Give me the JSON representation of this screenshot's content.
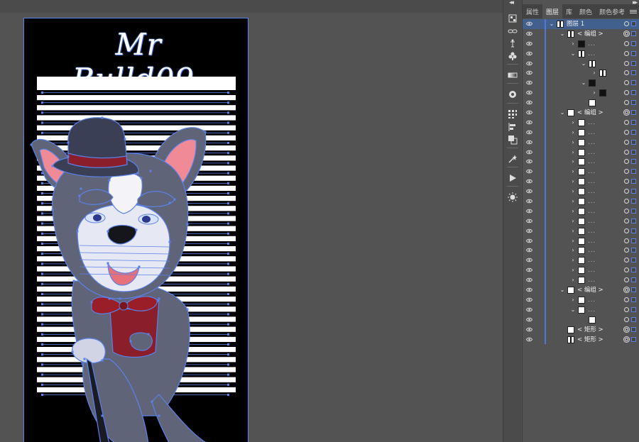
{
  "artwork": {
    "title": "Mr Bulld09."
  },
  "tools": [
    {
      "name": "artboards-icon"
    },
    {
      "name": "links-icon"
    },
    {
      "name": "puppet-warp-icon"
    },
    {
      "name": "symbols-icon"
    },
    {
      "name": "gradient-icon"
    },
    {
      "name": "appearance-icon"
    },
    {
      "name": "transform-grid-icon"
    },
    {
      "name": "align-icon"
    },
    {
      "name": "pathfinder-icon"
    },
    {
      "name": "magic-wand-icon"
    },
    {
      "name": "actions-icon"
    },
    {
      "name": "brightness-icon"
    }
  ],
  "panel": {
    "tabs": [
      {
        "label": "属性"
      },
      {
        "label": "图层"
      },
      {
        "label": "库"
      },
      {
        "label": "颜色"
      },
      {
        "label": "颜色参考"
      }
    ],
    "active_tab": "图层"
  },
  "layers": [
    {
      "indent": 0,
      "arrow": "v",
      "thumb": "split",
      "label": "图层 1",
      "selected": true,
      "target": "single"
    },
    {
      "indent": 1,
      "arrow": "v",
      "thumb": "split",
      "label": "< 编组 >",
      "target": "double"
    },
    {
      "indent": 2,
      "arrow": ">",
      "thumb": "dark",
      "label": "...",
      "target": "single"
    },
    {
      "indent": 2,
      "arrow": "v",
      "thumb": "split",
      "label": "...",
      "target": "single"
    },
    {
      "indent": 3,
      "arrow": "v",
      "thumb": "split",
      "label": "",
      "target": "single"
    },
    {
      "indent": 4,
      "arrow": ">",
      "thumb": "split",
      "label": "",
      "target": "single"
    },
    {
      "indent": 3,
      "arrow": "v",
      "thumb": "dark",
      "label": "",
      "target": "single"
    },
    {
      "indent": 4,
      "arrow": ">",
      "thumb": "dark",
      "label": "",
      "target": "single"
    },
    {
      "indent": 3,
      "arrow": "",
      "thumb": "white",
      "label": "",
      "target": "single"
    },
    {
      "indent": 1,
      "arrow": "v",
      "thumb": "white",
      "label": "< 编组 >",
      "target": "double"
    },
    {
      "indent": 2,
      "arrow": ">",
      "thumb": "white",
      "label": "...",
      "target": "single"
    },
    {
      "indent": 2,
      "arrow": ">",
      "thumb": "white",
      "label": "...",
      "target": "single"
    },
    {
      "indent": 2,
      "arrow": ">",
      "thumb": "white",
      "label": "...",
      "target": "single"
    },
    {
      "indent": 2,
      "arrow": ">",
      "thumb": "white",
      "label": "...",
      "target": "single"
    },
    {
      "indent": 2,
      "arrow": ">",
      "thumb": "white",
      "label": "...",
      "target": "single"
    },
    {
      "indent": 2,
      "arrow": ">",
      "thumb": "white",
      "label": "...",
      "target": "single"
    },
    {
      "indent": 2,
      "arrow": ">",
      "thumb": "white",
      "label": "...",
      "target": "single"
    },
    {
      "indent": 2,
      "arrow": ">",
      "thumb": "white",
      "label": "...",
      "target": "single"
    },
    {
      "indent": 2,
      "arrow": ">",
      "thumb": "white",
      "label": "...",
      "target": "single"
    },
    {
      "indent": 2,
      "arrow": ">",
      "thumb": "white",
      "label": "...",
      "target": "single"
    },
    {
      "indent": 2,
      "arrow": ">",
      "thumb": "white",
      "label": "...",
      "target": "single"
    },
    {
      "indent": 2,
      "arrow": ">",
      "thumb": "white",
      "label": "...",
      "target": "single"
    },
    {
      "indent": 2,
      "arrow": ">",
      "thumb": "white",
      "label": "...",
      "target": "single"
    },
    {
      "indent": 2,
      "arrow": ">",
      "thumb": "white",
      "label": "...",
      "target": "single"
    },
    {
      "indent": 2,
      "arrow": ">",
      "thumb": "white",
      "label": "...",
      "target": "single"
    },
    {
      "indent": 2,
      "arrow": ">",
      "thumb": "white",
      "label": "...",
      "target": "single"
    },
    {
      "indent": 2,
      "arrow": ">",
      "thumb": "white",
      "label": "...",
      "target": "single"
    },
    {
      "indent": 1,
      "arrow": "v",
      "thumb": "white",
      "label": "< 编组 >",
      "target": "double"
    },
    {
      "indent": 2,
      "arrow": ">",
      "thumb": "white",
      "label": "...",
      "target": "single"
    },
    {
      "indent": 2,
      "arrow": "v",
      "thumb": "white",
      "label": "...",
      "target": "single"
    },
    {
      "indent": 3,
      "arrow": "",
      "thumb": "white",
      "label": "",
      "target": "single"
    },
    {
      "indent": 1,
      "arrow": "",
      "thumb": "white",
      "label": "< 矩形 >",
      "target": "double"
    },
    {
      "indent": 1,
      "arrow": "",
      "thumb": "split",
      "label": "< 矩形 >",
      "target": "double"
    }
  ],
  "colors": {
    "selection_blue": "#5b82e8",
    "pink_ear": "#f08a96",
    "hat": "#3a3f55",
    "hat_band": "#8a1e2a",
    "fur_grey": "#5f6478",
    "bowtie": "#9a1e28"
  }
}
